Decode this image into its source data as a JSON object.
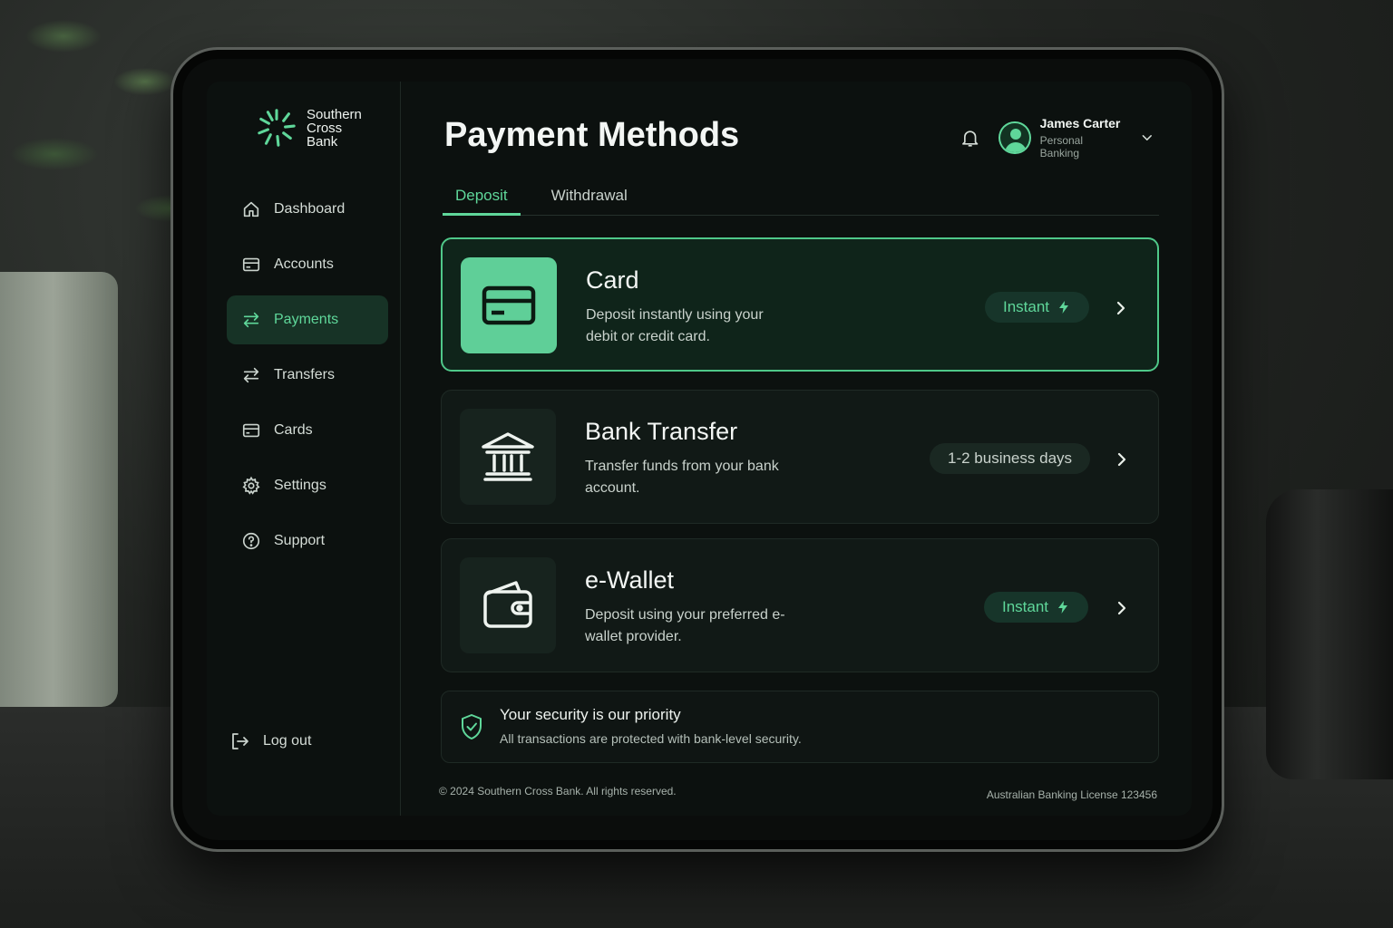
{
  "brand": {
    "name_line1": "Southern",
    "name_line2": "Cross",
    "name_line3": "Bank",
    "accent_color": "#5fd79a"
  },
  "sidebar": {
    "items": [
      {
        "label": "Dashboard",
        "icon": "home-icon",
        "active": false
      },
      {
        "label": "Accounts",
        "icon": "wallet-card-icon",
        "active": false
      },
      {
        "label": "Payments",
        "icon": "arrows-swap-icon",
        "active": true
      },
      {
        "label": "Transfers",
        "icon": "arrows-swap-icon",
        "active": false
      },
      {
        "label": "Cards",
        "icon": "credit-card-icon",
        "active": false
      },
      {
        "label": "Settings",
        "icon": "gear-icon",
        "active": false
      },
      {
        "label": "Support",
        "icon": "help-circle-icon",
        "active": false
      }
    ],
    "logout_label": "Log out"
  },
  "header": {
    "title": "Payment Methods",
    "user_name": "James Carter",
    "user_role": "Personal Banking"
  },
  "tabs": [
    {
      "label": "Deposit",
      "active": true
    },
    {
      "label": "Withdrawal",
      "active": false
    }
  ],
  "methods": [
    {
      "title": "Card",
      "description": "Deposit instantly using your debit or credit card.",
      "badge": "Instant",
      "icon": "credit-card-icon",
      "selected": true
    },
    {
      "title": "Bank Transfer",
      "description": "Transfer funds from your bank account.",
      "badge": "1-2 business days",
      "icon": "bank-icon",
      "selected": false
    },
    {
      "title": "e-Wallet",
      "description": "Deposit using your preferred e-wallet provider.",
      "badge": "Instant",
      "icon": "wallet-icon",
      "selected": false
    }
  ],
  "security": {
    "title": "Your security is our priority",
    "subtitle": "All transactions are protected with bank-level security."
  },
  "footer": {
    "copyright": "© 2024 Southern Cross Bank. All rights reserved.",
    "license": "Australian Banking License 123456"
  }
}
